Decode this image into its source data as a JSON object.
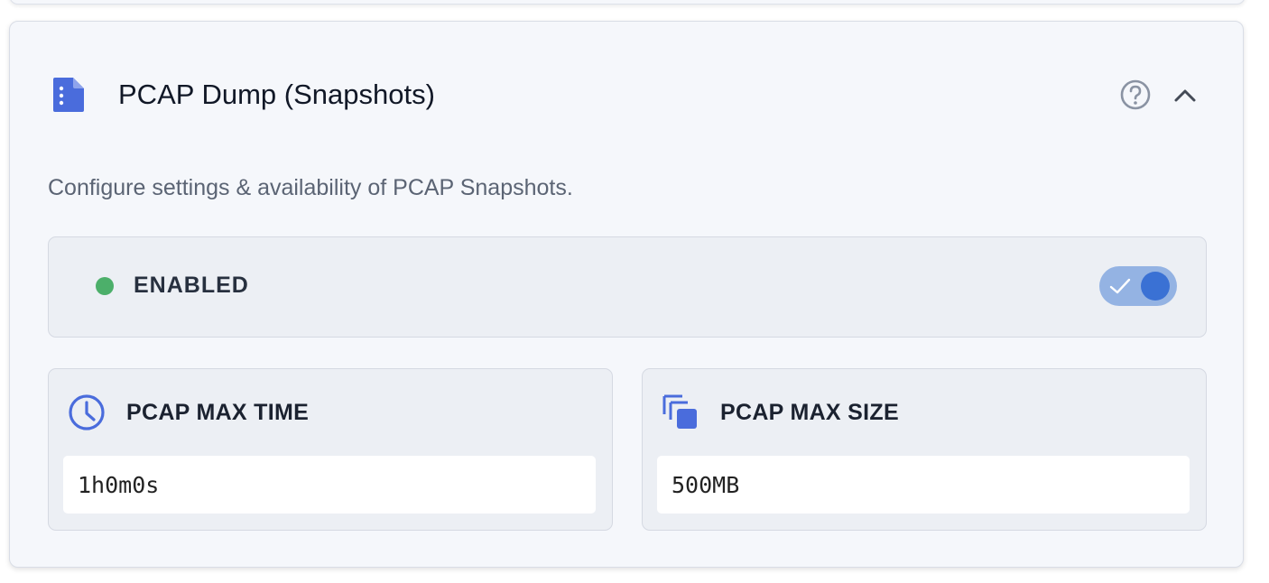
{
  "section": {
    "title": "PCAP Dump (Snapshots)",
    "description": "Configure settings & availability of PCAP Snapshots.",
    "header_icon": "document-icon",
    "help_icon": "help-circle-icon",
    "collapse_icon": "chevron-up-icon"
  },
  "status": {
    "label": "ENABLED",
    "enabled": true,
    "dot_color": "#4caf6a",
    "toggle_color": "#3a71d4"
  },
  "fields": {
    "max_time": {
      "label": "PCAP MAX TIME",
      "value": "1h0m0s",
      "icon": "clock-icon"
    },
    "max_size": {
      "label": "PCAP MAX SIZE",
      "value": "500MB",
      "icon": "copy-icon"
    }
  },
  "colors": {
    "accent": "#4a6cdc",
    "card_bg": "#f5f7fb",
    "panel_bg": "#eceff4"
  }
}
